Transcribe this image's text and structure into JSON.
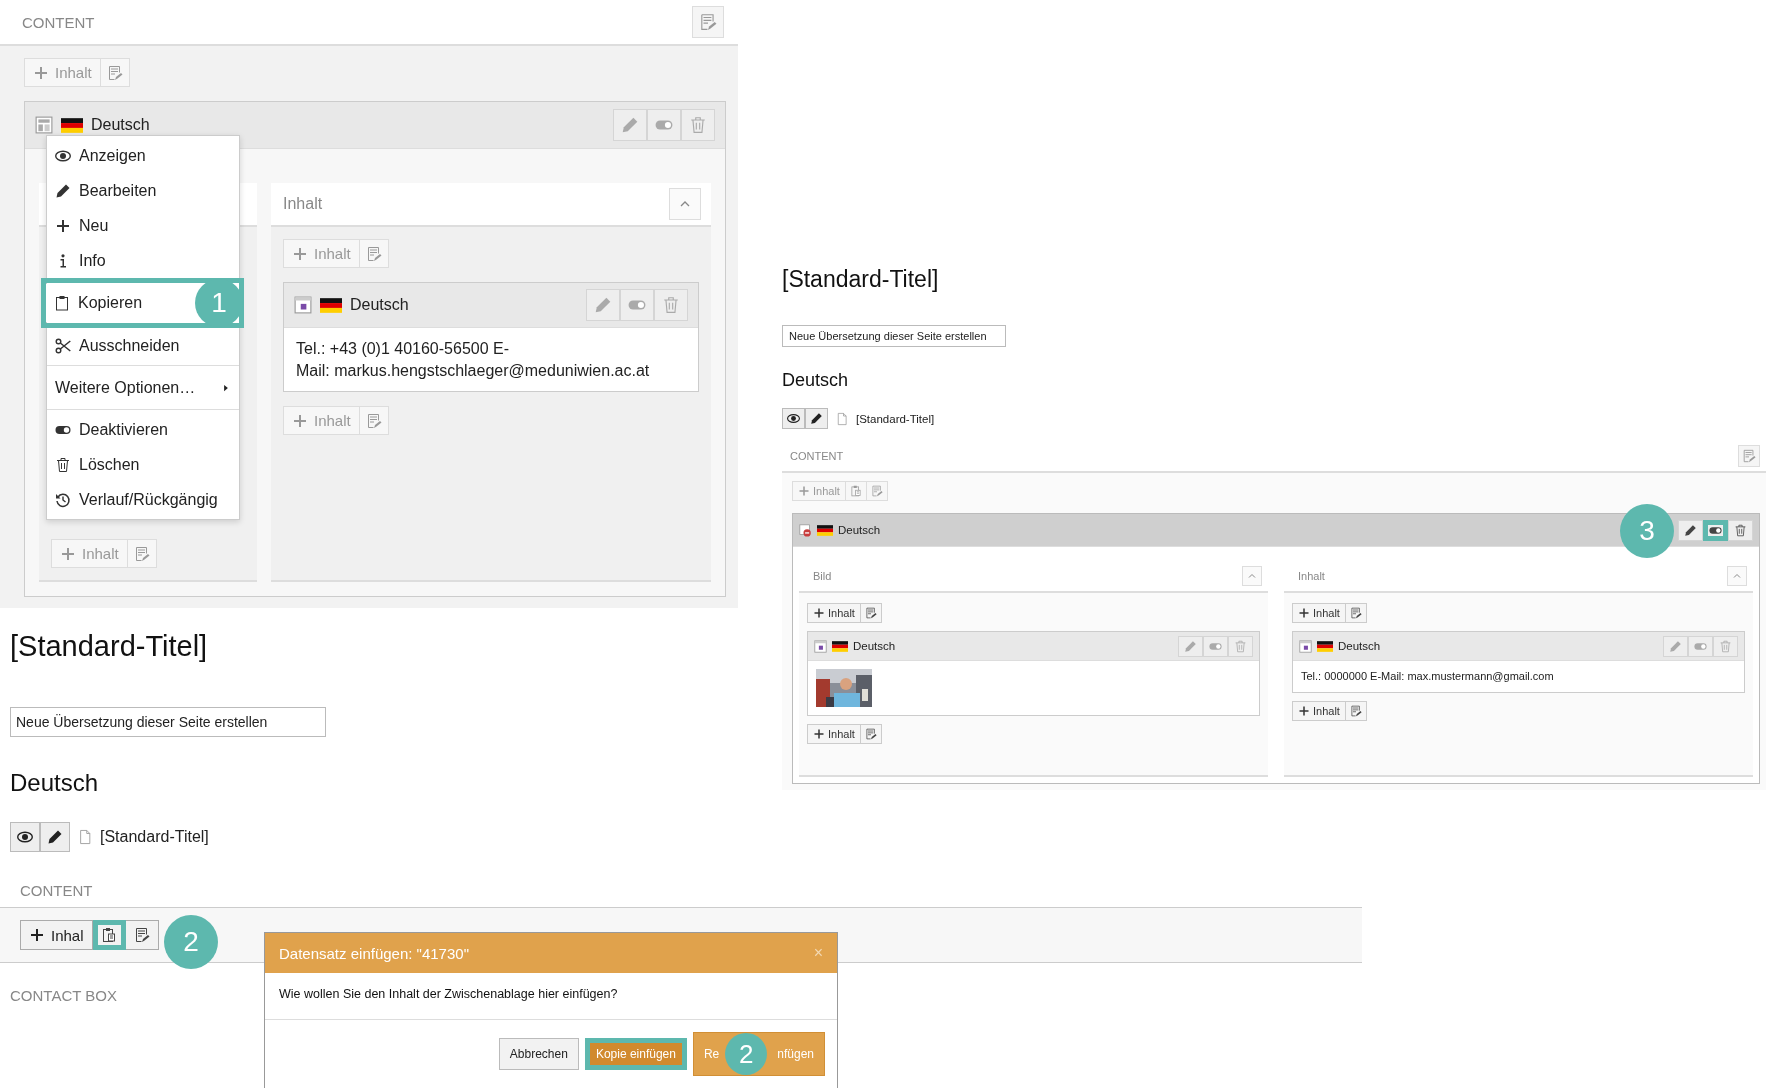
{
  "screenshot_1": {
    "section_title": "CONTENT",
    "add_button": "Inhalt",
    "element": {
      "language": "Deutsch"
    },
    "left_column": {
      "add_button": "Inhalt"
    },
    "right_column": {
      "title": "Inhalt",
      "add_button_top": "Inhalt",
      "element": {
        "language": "Deutsch",
        "text_lines": [
          "Tel.: +43 (0)1 40160-56500 E-",
          "Mail: markus.hengstschlaeger@meduniwien.ac.at"
        ]
      },
      "add_button_bottom": "Inhalt"
    },
    "context_menu": {
      "groups": [
        [
          {
            "label": "Anzeigen",
            "kind": "action",
            "selected": false
          },
          {
            "label": "Bearbeiten",
            "kind": "action",
            "selected": false
          },
          {
            "label": "Neu",
            "kind": "action",
            "selected": false
          },
          {
            "label": "Info",
            "kind": "action",
            "selected": false
          },
          {
            "label": "Kopieren",
            "kind": "action",
            "selected": true
          },
          {
            "label": "Ausschneiden",
            "kind": "action",
            "selected": false
          }
        ],
        [
          {
            "label": "Weitere Optionen…",
            "kind": "submenu",
            "selected": false
          }
        ],
        [
          {
            "label": "Deaktivieren",
            "kind": "action",
            "selected": false
          },
          {
            "label": "Löschen",
            "kind": "action",
            "selected": false
          },
          {
            "label": "Verlauf/Rückgängig",
            "kind": "action",
            "selected": false
          }
        ]
      ]
    },
    "step_badge": "1"
  },
  "screenshot_2": {
    "page_title": "[Standard-Titel]",
    "translation_select": "Neue Übersetzung dieser Seite erstellen",
    "language_heading": "Deutsch",
    "page_link": "[Standard-Titel]",
    "section_title": "CONTENT",
    "add_button": "Inhalt",
    "element": {
      "language": "Deutsch",
      "hidden": true,
      "toggle_selected": true
    },
    "columns": [
      {
        "title": "Bild",
        "add_button_top": "Inhalt",
        "element": {
          "language": "Deutsch",
          "kind": "picture"
        },
        "add_button_bottom": "Inhalt"
      },
      {
        "title": "Inhalt",
        "add_button_top": "Inhalt",
        "element": {
          "language": "Deutsch",
          "kind": "text",
          "text": "Tel.: 0000000 E-Mail: max.mustermann@gmail.com"
        },
        "add_button_bottom": "Inhalt"
      }
    ],
    "step_badge": "3"
  },
  "screenshot_3": {
    "page_title": "[Standard-Titel]",
    "translation_select": "Neue Übersetzung dieser Seite erstellen",
    "language_heading": "Deutsch",
    "page_link": "[Standard-Titel]",
    "section_title": "CONTENT",
    "add_button": "Inhal",
    "paste_selected": true,
    "step_badge": "2",
    "next_section_title": "CONTACT BOX",
    "dialog": {
      "title": "Datensatz einfügen: \"41730\"",
      "close": "×",
      "message": "Wie wollen Sie den Inhalt der Zwischenablage hier einfügen?",
      "buttons": [
        {
          "label": "Abbrechen",
          "kind": "default",
          "selected": false
        },
        {
          "label": "Kopie einfügen",
          "kind": "primary",
          "selected": true
        },
        {
          "label_parts": [
            "Re",
            "nfügen"
          ],
          "kind": "primary",
          "selected": false
        }
      ],
      "step_badge": "2"
    }
  }
}
